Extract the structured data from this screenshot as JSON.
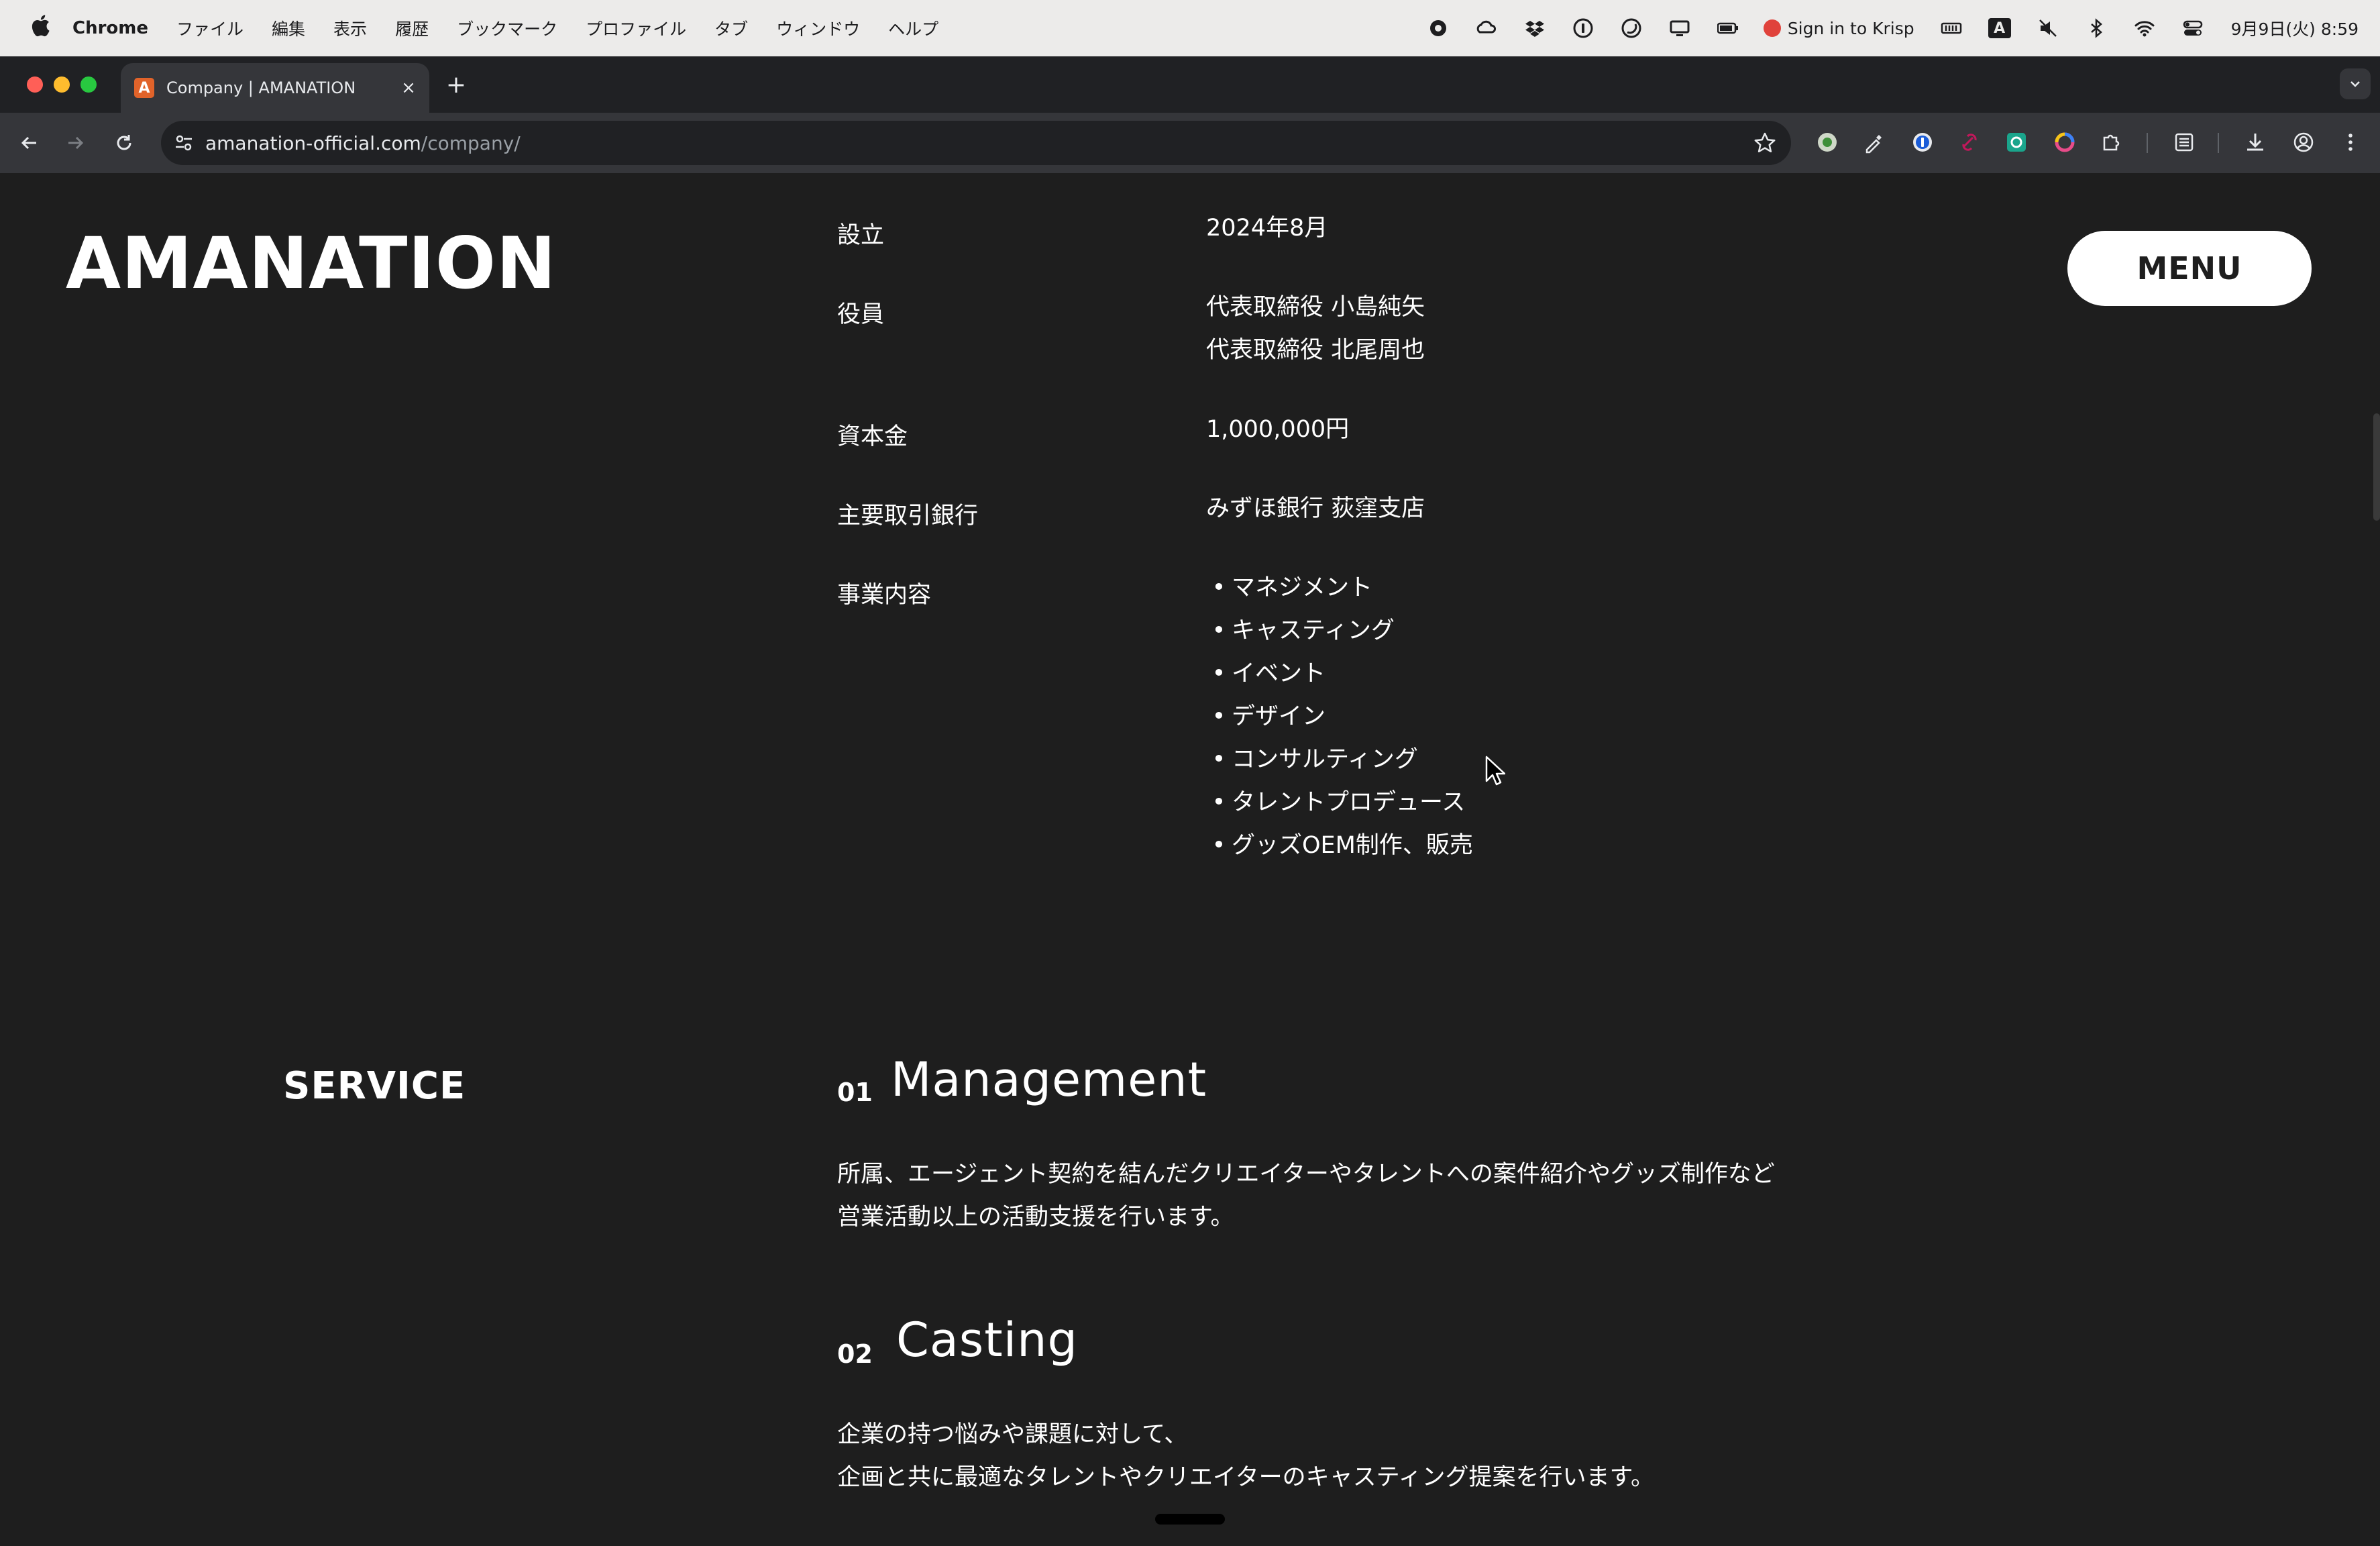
{
  "menubar": {
    "app_name": "Chrome",
    "items": [
      "ファイル",
      "編集",
      "表示",
      "履歴",
      "ブックマーク",
      "プロファイル",
      "タブ",
      "ウィンドウ",
      "ヘルプ"
    ],
    "krisp_label": "Sign in to Krisp",
    "keyboard_input": "A",
    "clock": "9月9日(火) 8:59"
  },
  "browser": {
    "tab_title": "Company | AMANATION",
    "favicon_letter": "A",
    "url_domain": "amanation-official.com",
    "url_path": "/company/"
  },
  "site": {
    "logo": "AMANATION",
    "menu_label": "MENU"
  },
  "company": {
    "founded_label": "設立",
    "founded_value": "2024年8月",
    "officers_label": "役員",
    "officers": [
      "代表取締役 小島純矢",
      "代表取締役 北尾周也"
    ],
    "capital_label": "資本金",
    "capital_value": "1,000,000円",
    "bank_label": "主要取引銀行",
    "bank_value": "みずほ銀行 荻窪支店",
    "business_label": "事業内容",
    "business": [
      "マネジメント",
      "キャスティング",
      "イベント",
      "デザイン",
      "コンサルティング",
      "タレントプロデュース",
      "グッズOEM制作、販売"
    ]
  },
  "service": {
    "heading": "SERVICE",
    "items": [
      {
        "num": "01",
        "title": "Management",
        "desc": [
          "所属、エージェント契約を結んだクリエイターやタレントへの案件紹介やグッズ制作など",
          "営業活動以上の活動支援を行います。"
        ]
      },
      {
        "num": "02",
        "title": "Casting",
        "desc": [
          "企業の持つ悩みや課題に対して、",
          "企画と共に最適なタレントやクリエイターのキャスティング提案を行います。"
        ]
      }
    ]
  },
  "colors": {
    "page_bg": "#1e1e1e",
    "text": "#ffffff",
    "menu_button_bg": "#ffffff",
    "tab_strip_bg": "#202124",
    "toolbar_bg": "#35363a",
    "favicon": "#e1632a"
  },
  "icons": [
    "apple-icon",
    "record-icon",
    "creative-cloud-icon",
    "dropbox-icon",
    "1password-icon",
    "moon-icon",
    "display-icon",
    "battery-icon",
    "krisp-icon",
    "memory-icon",
    "input-source-icon",
    "mute-icon",
    "bluetooth-icon",
    "wifi-icon",
    "control-center-icon",
    "back-icon",
    "forward-icon",
    "reload-icon",
    "site-info-icon",
    "bookmark-star-icon",
    "extensions-icon",
    "download-icon",
    "profile-icon",
    "more-icon"
  ]
}
